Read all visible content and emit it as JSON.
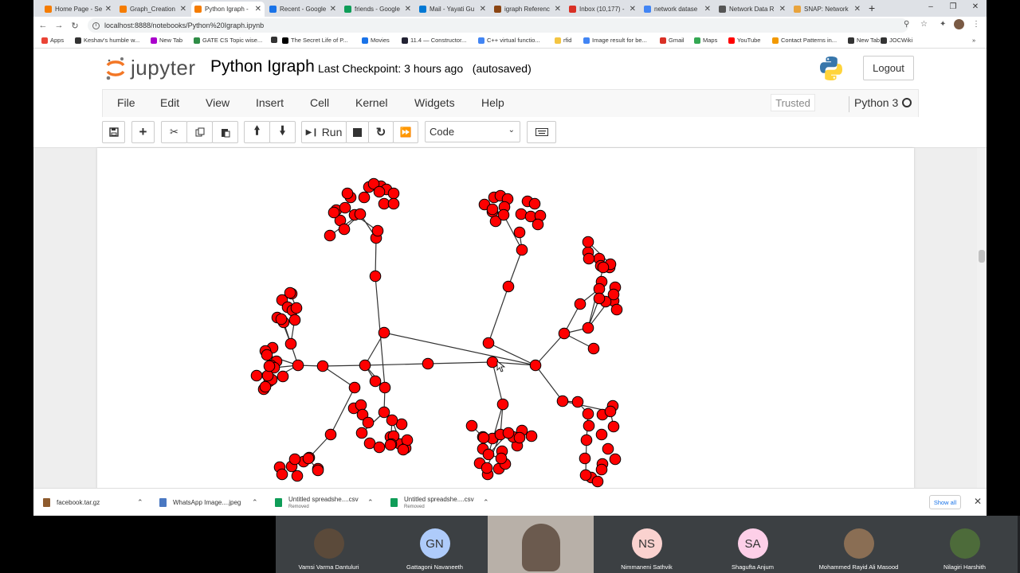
{
  "browser": {
    "tabs": [
      {
        "title": "Home Page - Se",
        "color": "#f57c00",
        "active": false
      },
      {
        "title": "Graph_Creation",
        "color": "#f57c00",
        "active": false
      },
      {
        "title": "Python Igraph -",
        "color": "#f57c00",
        "active": true
      },
      {
        "title": "Recent - Google",
        "color": "#1a73e8",
        "active": false
      },
      {
        "title": "friends - Google",
        "color": "#0f9d58",
        "active": false
      },
      {
        "title": "Mail - Yayati Gu",
        "color": "#0078d4",
        "active": false
      },
      {
        "title": "igraph Referenc",
        "color": "#8b4513",
        "active": false
      },
      {
        "title": "Inbox (10,177) -",
        "color": "#d93025",
        "active": false
      },
      {
        "title": "network datase",
        "color": "#4285f4",
        "active": false
      },
      {
        "title": "Network Data R",
        "color": "#555555",
        "active": false
      },
      {
        "title": "SNAP: Network",
        "color": "#e8a33d",
        "active": false
      }
    ],
    "new_tab": "+",
    "url": "localhost:8888/notebooks/Python%20Igraph.ipynb",
    "bookmarks": [
      {
        "label": "Apps",
        "color": "#ea4335"
      },
      {
        "label": "Keshav's humble w...",
        "color": "#333333"
      },
      {
        "label": "New Tab",
        "color": "#a0c"
      },
      {
        "label": "GATE CS Topic wise...",
        "color": "#2f8d46"
      },
      {
        "label": "",
        "color": "#333333"
      },
      {
        "label": "The Secret Life of P...",
        "color": "#000000"
      },
      {
        "label": "Movies",
        "color": "#1a73e8"
      },
      {
        "label": "11.4 — Constructor...",
        "color": "#223"
      },
      {
        "label": "C++ virtual functio...",
        "color": "#4285f4"
      },
      {
        "label": "rfid",
        "color": "#f4c542"
      },
      {
        "label": "Image result for be...",
        "color": "#4285f4"
      },
      {
        "label": "Gmail",
        "color": "#d93025"
      },
      {
        "label": "Maps",
        "color": "#34a853"
      },
      {
        "label": "YouTube",
        "color": "#ff0000"
      },
      {
        "label": "Contact Patterns in...",
        "color": "#f29900"
      },
      {
        "label": "New Tab",
        "color": "#333333"
      },
      {
        "label": "JOCWiki",
        "color": "#333333"
      }
    ]
  },
  "jupyter": {
    "logo_text": "jupyter",
    "notebook_name": "Python Igraph",
    "checkpoint": "Last Checkpoint: 3 hours ago",
    "autosave": "(autosaved)",
    "logout": "Logout",
    "menu": [
      "File",
      "Edit",
      "View",
      "Insert",
      "Cell",
      "Kernel",
      "Widgets",
      "Help"
    ],
    "trusted": "Trusted",
    "kernel": "Python 3",
    "run_label": "Run",
    "cell_type": "Code"
  },
  "graph_colors": {
    "node_fill": "#ff0000",
    "node_stroke": "#000000",
    "edge": "#333333"
  },
  "downloads": [
    {
      "name": "facebook.tar.gz",
      "status": "",
      "color": "#8e5b2e"
    },
    {
      "name": "WhatsApp Image....jpeg",
      "status": "",
      "color": "#4a78c2"
    },
    {
      "name": "Untitled spreadshe....csv",
      "status": "Removed",
      "color": "#0f9d58"
    },
    {
      "name": "Untitled spreadshe....csv",
      "status": "Removed",
      "color": "#0f9d58"
    }
  ],
  "show_all": "Show all",
  "participants": [
    {
      "name": "Vamsi Varma Dantuluri",
      "initials": "",
      "color": "#5b4a3a"
    },
    {
      "name": "Gattagoni Navaneeth",
      "initials": "GN",
      "color": "#aecbfa"
    },
    {
      "name": "",
      "initials": "",
      "color": "#6b5a4e"
    },
    {
      "name": "Nimmaneni Sathvik",
      "initials": "NS",
      "color": "#fad2cf"
    },
    {
      "name": "Shagufta Anjum",
      "initials": "SA",
      "color": "#fdcfe8"
    },
    {
      "name": "Mohammed Rayid Ali Masood",
      "initials": "",
      "color": "#8a6e54"
    },
    {
      "name": "Nilagiri Harshith",
      "initials": "",
      "color": "#4d6b3a"
    }
  ]
}
